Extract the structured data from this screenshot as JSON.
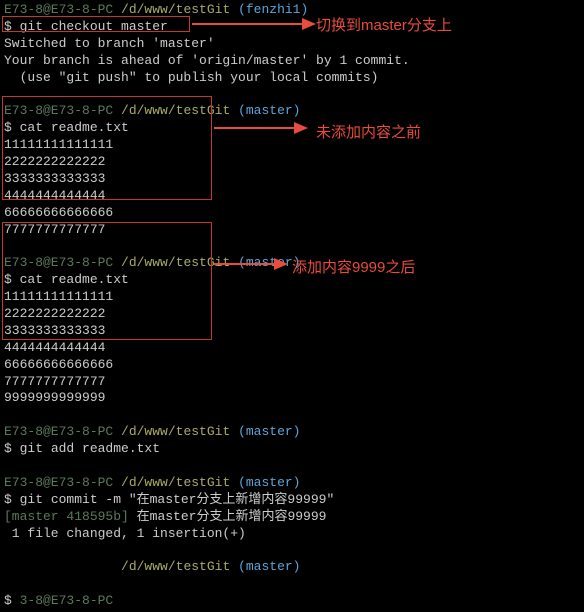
{
  "blocks": [
    {
      "prompt": {
        "user": "E73-8@E73-8-PC",
        "path": "/d/www/testGit",
        "branch": "(fenzhi1)"
      },
      "command": "git checkout master",
      "output": [
        "Switched to branch 'master'",
        "Your branch is ahead of 'origin/master' by 1 commit.",
        "  (use \"git push\" to publish your local commits)"
      ]
    },
    {
      "prompt": {
        "user": "E73-8@E73-8-PC",
        "path": "/d/www/testGit",
        "branch": "(master)"
      },
      "command": "cat readme.txt",
      "output": [
        "11111111111111",
        "2222222222222",
        "3333333333333",
        "4444444444444",
        "66666666666666",
        "7777777777777"
      ]
    },
    {
      "prompt": {
        "user": "E73-8@E73-8-PC",
        "path": "/d/www/testGit",
        "branch": "(master)"
      },
      "command": "cat readme.txt",
      "output": [
        "11111111111111",
        "2222222222222",
        "3333333333333",
        "4444444444444",
        "66666666666666",
        "7777777777777",
        "9999999999999"
      ]
    },
    {
      "prompt": {
        "user": "E73-8@E73-8-PC",
        "path": "/d/www/testGit",
        "branch": "(master)"
      },
      "command": "git add readme.txt",
      "output": []
    },
    {
      "prompt": {
        "user": "E73-8@E73-8-PC",
        "path": "/d/www/testGit",
        "branch": "(master)"
      },
      "command": "git commit -m \"在master分支上新增内容99999\"",
      "output_hash": "[master 418595b]",
      "output_msg": "在master分支上新增内容99999",
      "output_tail": " 1 file changed, 1 insertion(+)"
    },
    {
      "prompt": {
        "user": "",
        "path": "/d/www/testGit",
        "branch": "(master)"
      },
      "command": "",
      "output": []
    },
    {
      "prompt": {
        "user": "3-8@E73-8-PC",
        "path": "",
        "branch": ""
      },
      "command": "",
      "output": []
    }
  ],
  "annotations": {
    "a1": "切换到master分支上",
    "a2": "未添加内容之前",
    "a3": "添加内容9999之后"
  }
}
